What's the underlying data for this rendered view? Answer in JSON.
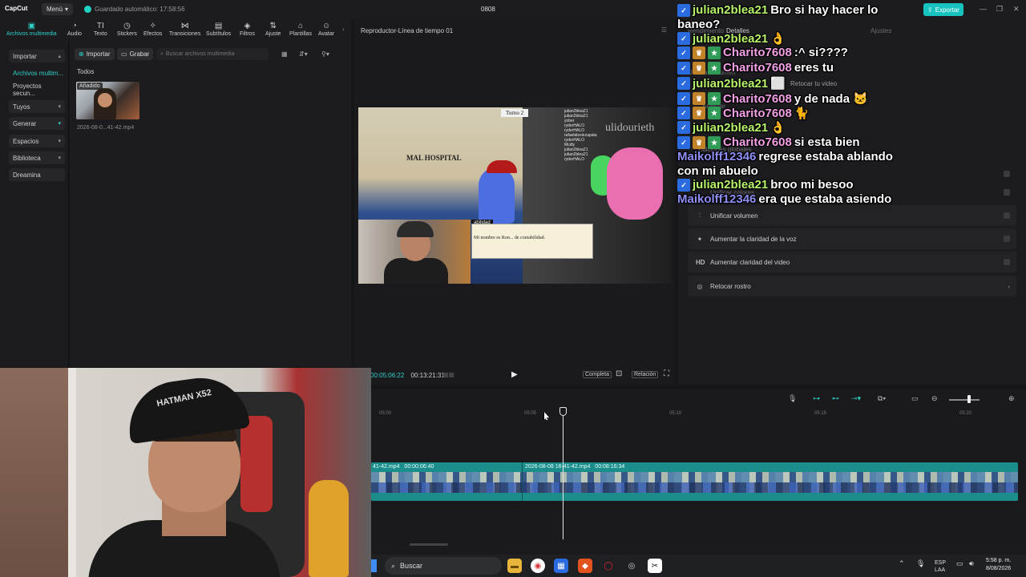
{
  "topbar": {
    "logo": "CapCut",
    "menu_label": "Menú",
    "autosave": "Guardado automático: 17:58:56",
    "project_title": "0808",
    "export_label": "Exportar"
  },
  "tooltabs": [
    {
      "label": "Archivos multimedia",
      "icon": "media-icon"
    },
    {
      "label": "Audio",
      "icon": "audio-icon"
    },
    {
      "label": "Texto",
      "icon": "text-icon"
    },
    {
      "label": "Stickers",
      "icon": "sticker-icon"
    },
    {
      "label": "Efectos",
      "icon": "effects-icon"
    },
    {
      "label": "Transiciones",
      "icon": "transitions-icon"
    },
    {
      "label": "Subtítulos",
      "icon": "subtitles-icon"
    },
    {
      "label": "Filtros",
      "icon": "filters-icon"
    },
    {
      "label": "Ajuste",
      "icon": "adjust-icon"
    },
    {
      "label": "Plantillas",
      "icon": "templates-icon"
    },
    {
      "label": "Avatar",
      "icon": "avatar-icon"
    }
  ],
  "leftnav": {
    "import_btn": "Importar",
    "items": [
      "Archivos multim...",
      "Proyectos secun..."
    ],
    "groups": [
      "Tuyos",
      "Generar",
      "Espacios",
      "Biblioteca",
      "Dreamina"
    ]
  },
  "media": {
    "import_label": "Importar",
    "record_label": "Grabar",
    "search_placeholder": "Buscar archivos multimedia",
    "section": "Todos",
    "added_badge": "Añadido",
    "file_name": "2026-08-0...41-42.mp4"
  },
  "player": {
    "title": "Reproductor-Línea de tiempo 01",
    "current_time": "00:05:06:22",
    "total_time": "00:13:21:31",
    "full_label": "Completa",
    "ratio_label": "Relación",
    "turno": "Turno 2",
    "hospital": "MAL HOSPITAL",
    "dialog_tag": "abilidad",
    "dialog_text": "Mi nombre es Ron... de contabilidad.",
    "watermark": "ulidourieth",
    "mini_chat": [
      "julian2blea21",
      "julian2blea21",
      "yober",
      "ryderHALO",
      "ryderHALO",
      "rafaelalesiezapata",
      "ryderHALO",
      "Mcdly",
      "julian2blea21",
      "julian2blea21",
      "ryderHALO"
    ]
  },
  "details": {
    "tab": "Detalles",
    "faint": [
      "Rendimiento",
      "Ajustes",
      "Unificar volumen",
      "Analizar",
      "Ediciones globales",
      "Unificar colores"
    ],
    "retouch_hint": "Retocar tu video",
    "rows": [
      {
        "label": "Unificar volumen",
        "icon": "volume-bars-icon"
      },
      {
        "label": "Aumentar la claridad de la voz",
        "icon": "voice-sparkle-icon"
      },
      {
        "label": "Aumentar claridad del video",
        "icon": "hd-icon"
      },
      {
        "label": "Retocar rostro",
        "icon": "face-retouch-icon"
      }
    ]
  },
  "chat": [
    {
      "user": "julian2blea21",
      "text": "Bro si hay hacer lo",
      "color": "green",
      "badges": [
        "kick"
      ]
    },
    {
      "user": "",
      "text": "baneo?",
      "color": "green",
      "badges": []
    },
    {
      "user": "julian2blea21",
      "text": "👌",
      "color": "green",
      "badges": [
        "kick"
      ]
    },
    {
      "user": "Charito7608",
      "text": ":^ si????",
      "color": "pink",
      "badges": [
        "kick",
        "crown",
        "sub"
      ]
    },
    {
      "user": "Charito7608",
      "text": "eres tu",
      "color": "pink",
      "badges": [
        "kick",
        "crown",
        "sub"
      ]
    },
    {
      "user": "julian2blea21",
      "text": "⬜",
      "color": "green",
      "badges": [
        "kick"
      ]
    },
    {
      "user": "Charito7608",
      "text": "y de nada 🐱",
      "color": "pink",
      "badges": [
        "kick",
        "crown",
        "sub"
      ]
    },
    {
      "user": "Charito7608",
      "text": "🐈",
      "color": "pink",
      "badges": [
        "kick",
        "crown",
        "sub"
      ]
    },
    {
      "user": "julian2blea21",
      "text": "👌",
      "color": "green",
      "badges": [
        "kick"
      ]
    },
    {
      "user": "Charito7608",
      "text": "si esta bien",
      "color": "pink",
      "badges": [
        "kick",
        "crown",
        "sub"
      ]
    },
    {
      "user": "Maikolff12346",
      "text": "regrese estaba ablando",
      "color": "blue",
      "badges": []
    },
    {
      "user": "",
      "text": "con mi abuelo",
      "color": "white",
      "badges": []
    },
    {
      "user": "julian2blea21",
      "text": "broo mi besoo",
      "color": "green",
      "badges": [
        "kick"
      ]
    },
    {
      "user": "Maikolff12346",
      "text": "era que estaba asiendo",
      "color": "blue",
      "badges": []
    }
  ],
  "webcam": {
    "cap_text": "HATMAN X52"
  },
  "timeline": {
    "ticks": [
      "05:00",
      "05:05",
      "05:10",
      "05:15",
      "05:20"
    ],
    "clip1_name": "41-42.mp4",
    "clip1_dur": "00:00:06:40",
    "clip2_name": "2026-08-08 16-41-42.mp4",
    "clip2_dur": "00:08:16:34"
  },
  "taskbar": {
    "search": "Buscar",
    "lang": "ESP",
    "lang2": "LAA",
    "time": "5:58 p. m.",
    "date": "8/08/2026"
  }
}
